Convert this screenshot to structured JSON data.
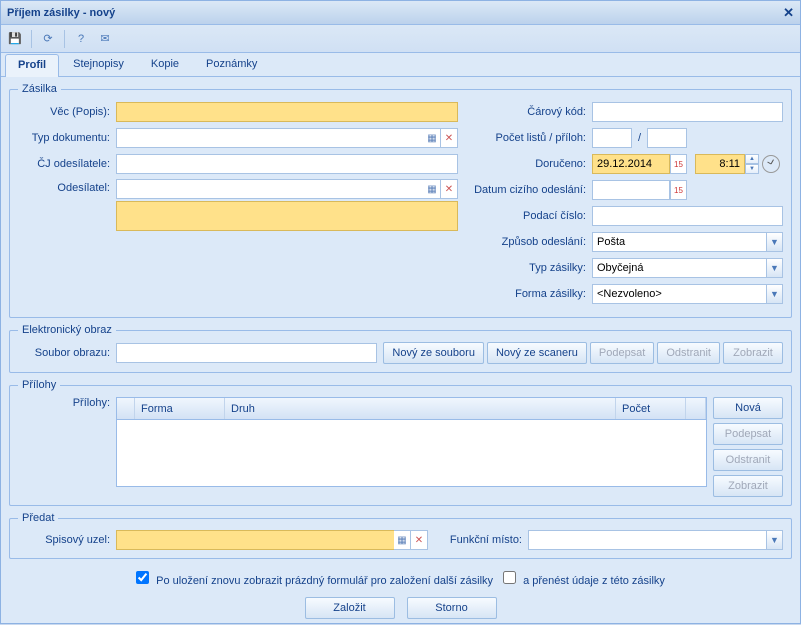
{
  "title": "Příjem zásilky - nový",
  "tabs": {
    "profil": "Profil",
    "stejnopisy": "Stejnopisy",
    "kopie": "Kopie",
    "poznamky": "Poznámky"
  },
  "zasilka": {
    "legend": "Zásilka",
    "vec_lbl": "Věc (Popis):",
    "typ_lbl": "Typ dokumentu:",
    "cj_lbl": "ČJ odesílatele:",
    "odes_lbl": "Odesílatel:",
    "barcode_lbl": "Čárový kód:",
    "pocet_lbl": "Počet listů / příloh:",
    "slash": "/",
    "doruceno_lbl": "Doručeno:",
    "doruceno_date": "29.12.2014",
    "doruceno_time": "8:11",
    "datum_ciz_lbl": "Datum cizího odeslání:",
    "podaci_lbl": "Podací číslo:",
    "zpusob_lbl": "Způsob odeslání:",
    "zpusob_val": "Pošta",
    "typzas_lbl": "Typ zásilky:",
    "typzas_val": "Obyčejná",
    "forma_lbl": "Forma zásilky:",
    "forma_val": "<Nezvoleno>"
  },
  "eimage": {
    "legend": "Elektronický obraz",
    "soubor_lbl": "Soubor obrazu:",
    "btn_file": "Nový ze souboru",
    "btn_scan": "Nový ze scaneru",
    "btn_sign": "Podepsat",
    "btn_del": "Odstranit",
    "btn_show": "Zobrazit"
  },
  "attach": {
    "legend": "Přílohy",
    "lbl": "Přílohy:",
    "col_forma": "Forma",
    "col_druh": "Druh",
    "col_pocet": "Počet",
    "btn_new": "Nová",
    "btn_sign": "Podepsat",
    "btn_del": "Odstranit",
    "btn_show": "Zobrazit"
  },
  "predat": {
    "legend": "Předat",
    "spis_lbl": "Spisový uzel:",
    "funk_lbl": "Funkční místo:"
  },
  "footer": {
    "cb1": "Po uložení znovu zobrazit prázdný formulář pro založení další zásilky",
    "cb2": "a přenést údaje z této zásilky",
    "save": "Založit",
    "cancel": "Storno"
  }
}
